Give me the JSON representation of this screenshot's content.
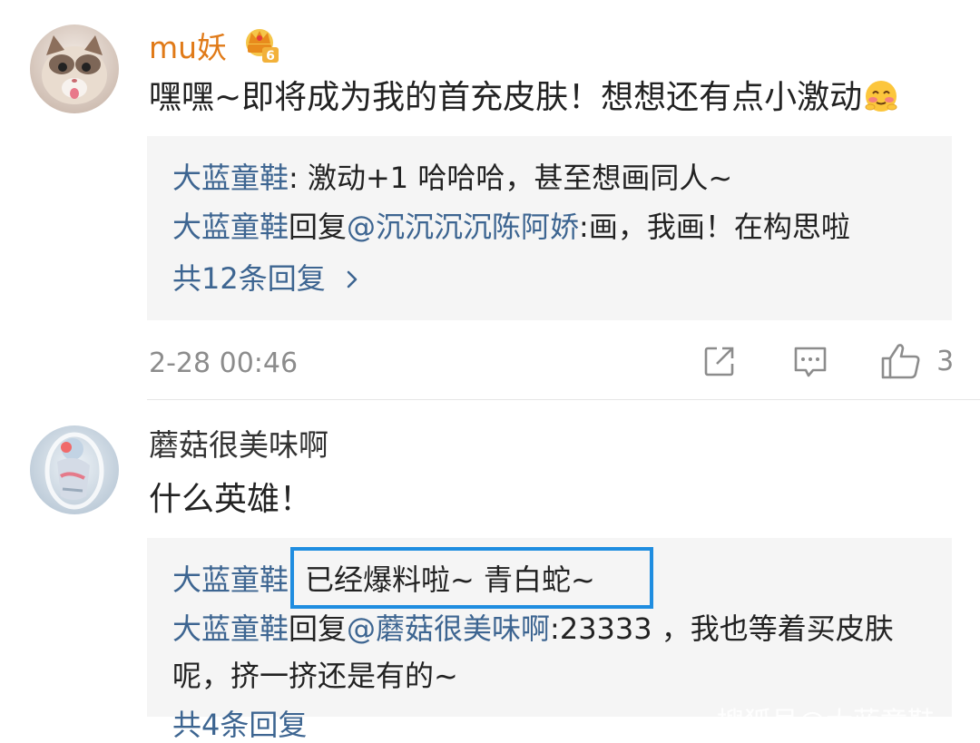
{
  "comments": [
    {
      "username": "mu妖",
      "username_color": "#e07a18",
      "badge_level": "6",
      "text": "嘿嘿~即将成为我的首充皮肤！想想还有点小激动",
      "replies": [
        {
          "author": "大蓝童鞋",
          "sep": ": ",
          "text": "激动+1  哈哈哈，甚至想画同人~"
        },
        {
          "author": "大蓝童鞋",
          "reply_word": "回复",
          "mention": "@沉沉沉沉陈阿娇",
          "text": ":画，我画！在构思啦"
        }
      ],
      "more_replies": "共12条回复",
      "timestamp": "2-28 00:46",
      "like_count": "3"
    },
    {
      "username": "蘑菇很美味啊",
      "username_color": "#333333",
      "text": "什么英雄！",
      "replies": [
        {
          "author": "大蓝童鞋",
          "text": "已经爆料啦~  青白蛇~"
        },
        {
          "author": "大蓝童鞋",
          "reply_word": "回复",
          "mention": "@蘑菇很美味啊",
          "text": ":23333 ，我也等着买皮肤",
          "text_cont": "呢，挤一挤还是有的~"
        }
      ],
      "more_replies": "共4条回复"
    }
  ],
  "watermark": "搜狐号@大蓝童鞋",
  "icons": {
    "share": "share-icon",
    "comment": "comment-icon",
    "like": "thumbs-up-icon",
    "badge": "crown-badge-icon",
    "emoji": "blushing-emoji-icon"
  },
  "colors": {
    "link": "#3d6591",
    "reply_bg": "#f5f5f5",
    "highlight": "#1f8de0",
    "meta": "#8c8c8c"
  }
}
